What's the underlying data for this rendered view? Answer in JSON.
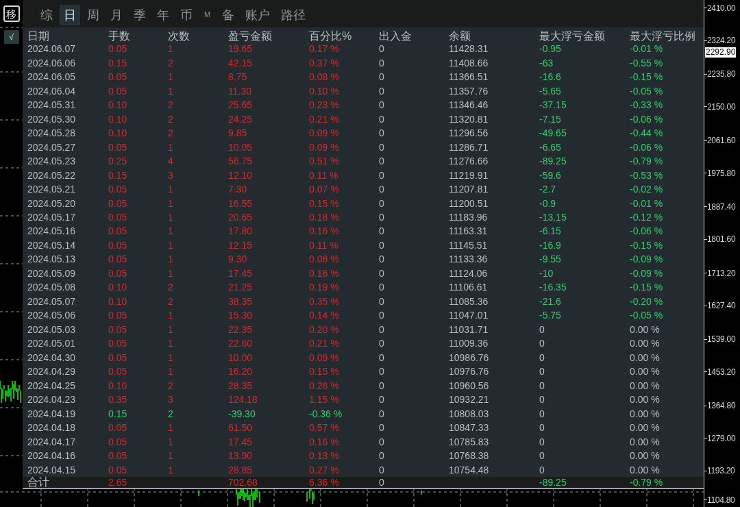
{
  "side_buttons": [
    {
      "label": "移",
      "kind": "outlined"
    },
    {
      "label": "√",
      "kind": "filled"
    }
  ],
  "tabs": [
    {
      "label": "综",
      "selected": false,
      "kind": "text"
    },
    {
      "label": "日",
      "selected": true,
      "kind": "text"
    },
    {
      "label": "周",
      "selected": false,
      "kind": "text"
    },
    {
      "label": "月",
      "selected": false,
      "kind": "text"
    },
    {
      "label": "季",
      "selected": false,
      "kind": "text"
    },
    {
      "label": "年",
      "selected": false,
      "kind": "text"
    },
    {
      "label": "币",
      "selected": false,
      "kind": "text"
    },
    {
      "label": "M",
      "selected": false,
      "kind": "small"
    },
    {
      "label": "备",
      "selected": false,
      "kind": "text"
    },
    {
      "label": "账户",
      "selected": false,
      "kind": "text"
    },
    {
      "label": "路径",
      "selected": false,
      "kind": "text"
    }
  ],
  "table": {
    "columns": [
      "日期",
      "手数",
      "次数",
      "盈亏金额",
      "百分比%",
      "出入金",
      "余额",
      "最大浮亏金额",
      "最大浮亏比例"
    ],
    "rows": [
      {
        "kind": "gain",
        "drawdown": true,
        "cells": [
          "2024.06.07",
          "0.05",
          "1",
          "19.65",
          "0.17 %",
          "0",
          "11428.31",
          "-0.95",
          "-0.01 %"
        ]
      },
      {
        "kind": "gain",
        "drawdown": true,
        "cells": [
          "2024.06.06",
          "0.15",
          "2",
          "42.15",
          "0.37 %",
          "0",
          "11408.66",
          "-63",
          "-0.55 %"
        ]
      },
      {
        "kind": "gain",
        "drawdown": true,
        "cells": [
          "2024.06.05",
          "0.05",
          "1",
          "8.75",
          "0.08 %",
          "0",
          "11366.51",
          "-16.6",
          "-0.15 %"
        ]
      },
      {
        "kind": "gain",
        "drawdown": true,
        "cells": [
          "2024.06.04",
          "0.05",
          "1",
          "11.30",
          "0.10 %",
          "0",
          "11357.76",
          "-5.65",
          "-0.05 %"
        ]
      },
      {
        "kind": "gain",
        "drawdown": true,
        "cells": [
          "2024.05.31",
          "0.10",
          "2",
          "25.65",
          "0.23 %",
          "0",
          "11346.46",
          "-37.15",
          "-0.33 %"
        ]
      },
      {
        "kind": "gain",
        "drawdown": true,
        "cells": [
          "2024.05.30",
          "0.10",
          "2",
          "24.25",
          "0.21 %",
          "0",
          "11320.81",
          "-7.15",
          "-0.06 %"
        ]
      },
      {
        "kind": "gain",
        "drawdown": true,
        "cells": [
          "2024.05.28",
          "0.10",
          "2",
          "9.85",
          "0.09 %",
          "0",
          "11296.56",
          "-49.65",
          "-0.44 %"
        ]
      },
      {
        "kind": "gain",
        "drawdown": true,
        "cells": [
          "2024.05.27",
          "0.05",
          "1",
          "10.05",
          "0.09 %",
          "0",
          "11286.71",
          "-6.65",
          "-0.06 %"
        ]
      },
      {
        "kind": "gain",
        "drawdown": true,
        "cells": [
          "2024.05.23",
          "0.25",
          "4",
          "56.75",
          "0.51 %",
          "0",
          "11276.66",
          "-89.25",
          "-0.79 %"
        ]
      },
      {
        "kind": "gain",
        "drawdown": true,
        "cells": [
          "2024.05.22",
          "0.15",
          "3",
          "12.10",
          "0.11 %",
          "0",
          "11219.91",
          "-59.6",
          "-0.53 %"
        ]
      },
      {
        "kind": "gain",
        "drawdown": true,
        "cells": [
          "2024.05.21",
          "0.05",
          "1",
          "7.30",
          "0.07 %",
          "0",
          "11207.81",
          "-2.7",
          "-0.02 %"
        ]
      },
      {
        "kind": "gain",
        "drawdown": true,
        "cells": [
          "2024.05.20",
          "0.05",
          "1",
          "16.55",
          "0.15 %",
          "0",
          "11200.51",
          "-0.9",
          "-0.01 %"
        ]
      },
      {
        "kind": "gain",
        "drawdown": true,
        "cells": [
          "2024.05.17",
          "0.05",
          "1",
          "20.65",
          "0.18 %",
          "0",
          "11183.96",
          "-13.15",
          "-0.12 %"
        ]
      },
      {
        "kind": "gain",
        "drawdown": true,
        "cells": [
          "2024.05.16",
          "0.05",
          "1",
          "17.80",
          "0.16 %",
          "0",
          "11163.31",
          "-6.15",
          "-0.06 %"
        ]
      },
      {
        "kind": "gain",
        "drawdown": true,
        "cells": [
          "2024.05.14",
          "0.05",
          "1",
          "12.15",
          "0.11 %",
          "0",
          "11145.51",
          "-16.9",
          "-0.15 %"
        ]
      },
      {
        "kind": "gain",
        "drawdown": true,
        "cells": [
          "2024.05.13",
          "0.05",
          "1",
          "9.30",
          "0.08 %",
          "0",
          "11133.36",
          "-9.55",
          "-0.09 %"
        ]
      },
      {
        "kind": "gain",
        "drawdown": true,
        "cells": [
          "2024.05.09",
          "0.05",
          "1",
          "17.45",
          "0.16 %",
          "0",
          "11124.06",
          "-10",
          "-0.09 %"
        ]
      },
      {
        "kind": "gain",
        "drawdown": true,
        "cells": [
          "2024.05.08",
          "0.10",
          "2",
          "21.25",
          "0.19 %",
          "0",
          "11106.61",
          "-16.35",
          "-0.15 %"
        ]
      },
      {
        "kind": "gain",
        "drawdown": true,
        "cells": [
          "2024.05.07",
          "0.10",
          "2",
          "38.35",
          "0.35 %",
          "0",
          "11085.36",
          "-21.6",
          "-0.20 %"
        ]
      },
      {
        "kind": "gain",
        "drawdown": true,
        "cells": [
          "2024.05.06",
          "0.05",
          "1",
          "15.30",
          "0.14 %",
          "0",
          "11047.01",
          "-5.75",
          "-0.05 %"
        ]
      },
      {
        "kind": "gain",
        "drawdown": false,
        "cells": [
          "2024.05.03",
          "0.05",
          "1",
          "22.35",
          "0.20 %",
          "0",
          "11031.71",
          "0",
          "0.00 %"
        ]
      },
      {
        "kind": "gain",
        "drawdown": false,
        "cells": [
          "2024.05.01",
          "0.05",
          "1",
          "22.60",
          "0.21 %",
          "0",
          "11009.36",
          "0",
          "0.00 %"
        ]
      },
      {
        "kind": "gain",
        "drawdown": false,
        "cells": [
          "2024.04.30",
          "0.05",
          "1",
          "10.00",
          "0.09 %",
          "0",
          "10986.76",
          "0",
          "0.00 %"
        ]
      },
      {
        "kind": "gain",
        "drawdown": false,
        "cells": [
          "2024.04.29",
          "0.05",
          "1",
          "16.20",
          "0.15 %",
          "0",
          "10976.76",
          "0",
          "0.00 %"
        ]
      },
      {
        "kind": "gain",
        "drawdown": false,
        "cells": [
          "2024.04.25",
          "0.10",
          "2",
          "28.35",
          "0.26 %",
          "0",
          "10960.56",
          "0",
          "0.00 %"
        ]
      },
      {
        "kind": "gain",
        "drawdown": false,
        "cells": [
          "2024.04.23",
          "0.35",
          "3",
          "124.18",
          "1.15 %",
          "0",
          "10932.21",
          "0",
          "0.00 %"
        ]
      },
      {
        "kind": "loss",
        "drawdown": false,
        "cells": [
          "2024.04.19",
          "0.15",
          "2",
          "-39.30",
          "-0.36 %",
          "0",
          "10808.03",
          "0",
          "0.00 %"
        ]
      },
      {
        "kind": "gain",
        "drawdown": false,
        "cells": [
          "2024.04.18",
          "0.05",
          "1",
          "61.50",
          "0.57 %",
          "0",
          "10847.33",
          "0",
          "0.00 %"
        ]
      },
      {
        "kind": "gain",
        "drawdown": false,
        "cells": [
          "2024.04.17",
          "0.05",
          "1",
          "17.45",
          "0.16 %",
          "0",
          "10785.83",
          "0",
          "0.00 %"
        ]
      },
      {
        "kind": "gain",
        "drawdown": false,
        "cells": [
          "2024.04.16",
          "0.05",
          "1",
          "13.90",
          "0.13 %",
          "0",
          "10768.38",
          "0",
          "0.00 %"
        ]
      },
      {
        "kind": "gain",
        "drawdown": false,
        "cells": [
          "2024.04.15",
          "0.05",
          "1",
          "28.85",
          "0.27 %",
          "0",
          "10754.48",
          "0",
          "0.00 %"
        ]
      }
    ],
    "total": {
      "label": "合计",
      "lots": "2.65",
      "profit": "702.68",
      "percent": "6.36 %",
      "deposit": "0",
      "max_float": "-89.25",
      "max_float_percent": "-0.79 %"
    }
  },
  "price_axis": [
    {
      "label": "2410.00",
      "kind": "tick"
    },
    {
      "label": "2324.20",
      "kind": "tick"
    },
    {
      "label": "2292.90",
      "kind": "current"
    },
    {
      "label": "2235.80",
      "kind": "tick"
    },
    {
      "label": "2150.00",
      "kind": "tick"
    },
    {
      "label": "2061.60",
      "kind": "tick"
    },
    {
      "label": "1975.80",
      "kind": "tick"
    },
    {
      "label": "1887.40",
      "kind": "tick"
    },
    {
      "label": "1801.60",
      "kind": "tick"
    },
    {
      "label": "1713.20",
      "kind": "tick"
    },
    {
      "label": "1627.40",
      "kind": "tick"
    },
    {
      "label": "1539.00",
      "kind": "tick"
    },
    {
      "label": "1453.20",
      "kind": "tick"
    },
    {
      "label": "1364.80",
      "kind": "tick"
    },
    {
      "label": "1279.00",
      "kind": "tick"
    },
    {
      "label": "1193.20",
      "kind": "tick"
    },
    {
      "label": "1104.80",
      "kind": "tick"
    }
  ]
}
